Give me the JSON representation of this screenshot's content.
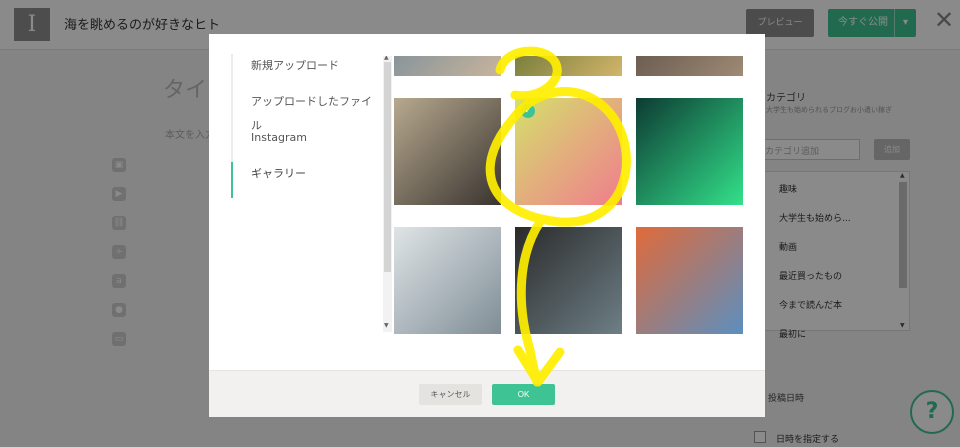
{
  "header": {
    "logo_letter": "I",
    "blog_title": "海を眺めるのが好きなヒト",
    "preview_label": "プレビュー",
    "publish_label": "今すぐ公開",
    "publish_caret": "▾",
    "close_glyph": "✕"
  },
  "editor": {
    "title_placeholder": "タイ",
    "body_placeholder": "本文を入力",
    "tools": [
      "image-tool-icon",
      "video-tool-icon",
      "link-tool-icon",
      "divider-tool-icon",
      "amazon-tool-icon",
      "embed-tool-icon",
      "more-tool-icon"
    ]
  },
  "right_panel": {
    "category_title": "カテゴリ",
    "category_sub": "大学生も始められるブログお小遣い稼ぎ",
    "category_input_placeholder": "カテゴリ追加",
    "category_add_label": "追加",
    "categories": [
      "趣味",
      "大学生も始めら...",
      "動画",
      "最近買ったもの",
      "今まで読んだ本",
      "最初に"
    ],
    "selected_category_index": 1,
    "post_date_label": "投稿日時",
    "date_specify_label": "日時を指定する"
  },
  "help_label": "?",
  "modal": {
    "nav": [
      {
        "label": "新規アップロード",
        "active": false
      },
      {
        "label": "アップロードしたファイル",
        "active": false
      },
      {
        "label": "Instagram",
        "active": false
      },
      {
        "label": "ギャラリー",
        "active": true
      }
    ],
    "gallery": [
      {
        "name": "gallery-image-fashion-partial",
        "palette": [
          "#5d7f99",
          "#c8b49c"
        ],
        "selected": false
      },
      {
        "name": "gallery-image-green-partial",
        "palette": [
          "#3f5a1f",
          "#d2b56a"
        ],
        "selected": false
      },
      {
        "name": "gallery-image-street-partial",
        "palette": [
          "#4b3f38",
          "#9e8a75"
        ],
        "selected": false
      },
      {
        "name": "gallery-image-clothing-store",
        "palette": [
          "#b7a98f",
          "#3a3430"
        ],
        "selected": false
      },
      {
        "name": "gallery-image-paint-palette",
        "palette": [
          "#d4e06b",
          "#f07d8e"
        ],
        "selected": true
      },
      {
        "name": "gallery-image-aurora",
        "palette": [
          "#0d3b33",
          "#33e08a"
        ],
        "selected": false
      },
      {
        "name": "gallery-image-architecture",
        "palette": [
          "#dfe4e6",
          "#7f8d96"
        ],
        "selected": false
      },
      {
        "name": "gallery-image-laptop",
        "palette": [
          "#2a2a2a",
          "#6d7f86"
        ],
        "selected": false
      },
      {
        "name": "gallery-image-colorful-abstract",
        "palette": [
          "#e06a3a",
          "#5b8fbf"
        ],
        "selected": false
      }
    ],
    "cancel_label": "キャンセル",
    "ok_label": "OK",
    "check_glyph": "✓"
  },
  "colors": {
    "accent": "#3ec494",
    "annotation": "#ffee00"
  }
}
